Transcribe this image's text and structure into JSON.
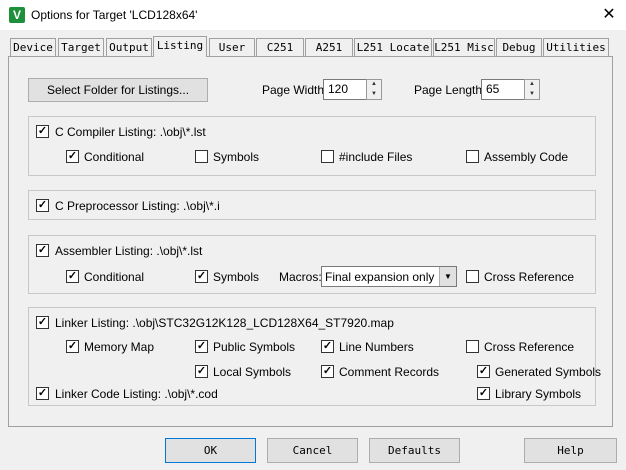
{
  "window": {
    "title": "Options for Target 'LCD128x64'"
  },
  "tabs": [
    "Device",
    "Target",
    "Output",
    "Listing",
    "User",
    "C251",
    "A251",
    "L251 Locate",
    "L251 Misc",
    "Debug",
    "Utilities"
  ],
  "active_tab": "Listing",
  "folder_button": "Select Folder for Listings...",
  "page_width": {
    "label": "Page Width:",
    "value": "120"
  },
  "page_length": {
    "label": "Page Length:",
    "value": "65"
  },
  "c_compiler": {
    "label": "C Compiler Listing:  .\\obj\\*.lst",
    "checked": true,
    "conditional": {
      "label": "Conditional",
      "checked": true
    },
    "symbols": {
      "label": "Symbols",
      "checked": false
    },
    "include_files": {
      "label": "#include Files",
      "checked": false
    },
    "assembly_code": {
      "label": "Assembly Code",
      "checked": false
    }
  },
  "c_preprocessor": {
    "label": "C Preprocessor Listing:  .\\obj\\*.i",
    "checked": true
  },
  "assembler": {
    "label": "Assembler Listing:  .\\obj\\*.lst",
    "checked": true,
    "conditional": {
      "label": "Conditional",
      "checked": true
    },
    "symbols": {
      "label": "Symbols",
      "checked": true
    },
    "macros_label": "Macros:",
    "macros_value": "Final expansion only",
    "cross_reference": {
      "label": "Cross Reference",
      "checked": false
    }
  },
  "linker": {
    "label": "Linker Listing:  .\\obj\\STC32G12K128_LCD128X64_ST7920.map",
    "checked": true,
    "memory_map": {
      "label": "Memory Map",
      "checked": true
    },
    "public_symbols": {
      "label": "Public Symbols",
      "checked": true
    },
    "line_numbers": {
      "label": "Line Numbers",
      "checked": true
    },
    "cross_reference": {
      "label": "Cross Reference",
      "checked": false
    },
    "local_symbols": {
      "label": "Local Symbols",
      "checked": true
    },
    "comment_records": {
      "label": "Comment Records",
      "checked": true
    },
    "generated_symbols": {
      "label": "Generated Symbols",
      "checked": true
    },
    "code_listing": {
      "label": "Linker Code Listing:  .\\obj\\*.cod",
      "checked": true
    },
    "library_symbols": {
      "label": "Library Symbols",
      "checked": true
    }
  },
  "buttons": {
    "ok": "OK",
    "cancel": "Cancel",
    "defaults": "Defaults",
    "help": "Help"
  },
  "check_glyph": "✓"
}
